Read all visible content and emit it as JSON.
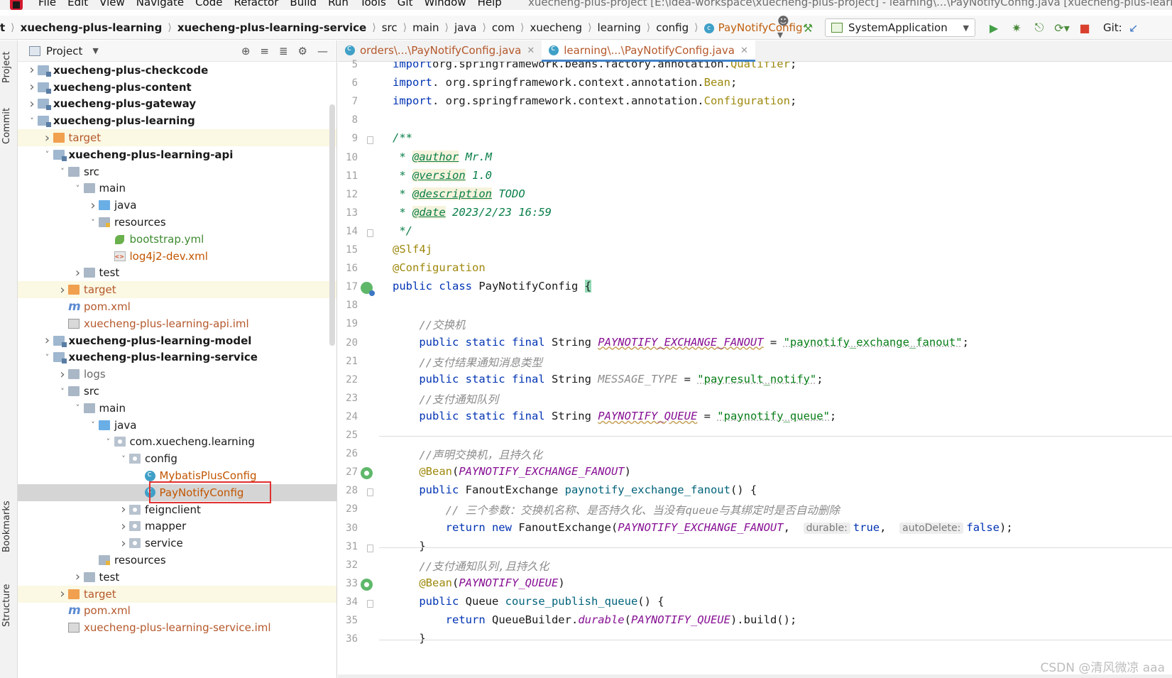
{
  "menu": {
    "items": [
      "File",
      "Edit",
      "View",
      "Navigate",
      "Code",
      "Refactor",
      "Build",
      "Run",
      "Tools",
      "Git",
      "Window",
      "Help"
    ],
    "window_title": "xuecheng-plus-project [E:\\idea-workspace\\xuecheng-plus-project] - learning\\...\\PayNotifyConfig.java [xuecheng-plus-learnin"
  },
  "breadcrumb": [
    {
      "label": "t",
      "bold": true
    },
    {
      "label": "xuecheng-plus-learning",
      "bold": true
    },
    {
      "label": "xuecheng-plus-learning-service",
      "bold": true
    },
    {
      "label": "src",
      "bold": false
    },
    {
      "label": "main",
      "bold": false
    },
    {
      "label": "java",
      "bold": false
    },
    {
      "label": "com",
      "bold": false
    },
    {
      "label": "xuecheng",
      "bold": false
    },
    {
      "label": "learning",
      "bold": false
    },
    {
      "label": "config",
      "bold": false
    },
    {
      "label": "PayNotifyConfig",
      "bold": false,
      "active": true
    }
  ],
  "toolbar": {
    "run_config": "SystemApplication",
    "git_label": "Git:"
  },
  "left_strip": {
    "tabs": [
      "Project",
      "Commit",
      "Bookmarks",
      "Structure"
    ]
  },
  "project_panel": {
    "title": "Project",
    "tree": [
      {
        "label": "xuecheng-plus-checkcode",
        "level": 1,
        "arrow": "right",
        "icon": "module",
        "style": "bold"
      },
      {
        "label": "xuecheng-plus-content",
        "level": 1,
        "arrow": "right",
        "icon": "module",
        "style": "bold"
      },
      {
        "label": "xuecheng-plus-gateway",
        "level": 1,
        "arrow": "right",
        "icon": "module",
        "style": "bold"
      },
      {
        "label": "xuecheng-plus-learning",
        "level": 1,
        "arrow": "down",
        "icon": "module",
        "style": "bold"
      },
      {
        "label": "target",
        "level": 2,
        "arrow": "right",
        "icon": "folder-orange",
        "style": "orange",
        "hl": true
      },
      {
        "label": "xuecheng-plus-learning-api",
        "level": 2,
        "arrow": "down",
        "icon": "module",
        "style": "bold"
      },
      {
        "label": "src",
        "level": 3,
        "arrow": "down",
        "icon": "folder",
        "style": ""
      },
      {
        "label": "main",
        "level": 4,
        "arrow": "down",
        "icon": "folder",
        "style": ""
      },
      {
        "label": "java",
        "level": 5,
        "arrow": "right",
        "icon": "folder-blue",
        "style": ""
      },
      {
        "label": "resources",
        "level": 5,
        "arrow": "down",
        "icon": "folder-res",
        "style": ""
      },
      {
        "label": "bootstrap.yml",
        "level": 6,
        "arrow": "",
        "icon": "yml",
        "style": "green"
      },
      {
        "label": "log4j2-dev.xml",
        "level": 6,
        "arrow": "",
        "icon": "xml",
        "style": "red"
      },
      {
        "label": "test",
        "level": 4,
        "arrow": "right",
        "icon": "folder",
        "style": ""
      },
      {
        "label": "target",
        "level": 3,
        "arrow": "right",
        "icon": "folder-orange",
        "style": "orange",
        "hl": true
      },
      {
        "label": "pom.xml",
        "level": 3,
        "arrow": "",
        "icon": "maven",
        "style": "orange"
      },
      {
        "label": "xuecheng-plus-learning-api.iml",
        "level": 3,
        "arrow": "",
        "icon": "iml",
        "style": "orange"
      },
      {
        "label": "xuecheng-plus-learning-model",
        "level": 2,
        "arrow": "right",
        "icon": "module",
        "style": "bold"
      },
      {
        "label": "xuecheng-plus-learning-service",
        "level": 2,
        "arrow": "down",
        "icon": "module",
        "style": "bold"
      },
      {
        "label": "logs",
        "level": 3,
        "arrow": "right",
        "icon": "folder",
        "style": "gray"
      },
      {
        "label": "src",
        "level": 3,
        "arrow": "down",
        "icon": "folder",
        "style": ""
      },
      {
        "label": "main",
        "level": 4,
        "arrow": "down",
        "icon": "folder",
        "style": ""
      },
      {
        "label": "java",
        "level": 5,
        "arrow": "down",
        "icon": "folder-blue",
        "style": ""
      },
      {
        "label": "com.xuecheng.learning",
        "level": 6,
        "arrow": "down",
        "icon": "package",
        "style": ""
      },
      {
        "label": "config",
        "level": 7,
        "arrow": "down",
        "icon": "package",
        "style": ""
      },
      {
        "label": "MybatisPlusConfig",
        "level": 8,
        "arrow": "",
        "icon": "class",
        "style": "red"
      },
      {
        "label": "PayNotifyConfig",
        "level": 8,
        "arrow": "",
        "icon": "class",
        "style": "red",
        "selected": true
      },
      {
        "label": "feignclient",
        "level": 7,
        "arrow": "right",
        "icon": "package",
        "style": ""
      },
      {
        "label": "mapper",
        "level": 7,
        "arrow": "right",
        "icon": "package",
        "style": ""
      },
      {
        "label": "service",
        "level": 7,
        "arrow": "right",
        "icon": "package",
        "style": ""
      },
      {
        "label": "resources",
        "level": 5,
        "arrow": "",
        "icon": "folder-res",
        "style": ""
      },
      {
        "label": "test",
        "level": 4,
        "arrow": "right",
        "icon": "folder",
        "style": ""
      },
      {
        "label": "target",
        "level": 3,
        "arrow": "right",
        "icon": "folder-orange",
        "style": "orange",
        "hl": true
      },
      {
        "label": "pom.xml",
        "level": 3,
        "arrow": "",
        "icon": "maven",
        "style": "orange"
      },
      {
        "label": "xuecheng-plus-learning-service.iml",
        "level": 3,
        "arrow": "",
        "icon": "iml",
        "style": "orange"
      }
    ]
  },
  "editor": {
    "tabs": [
      {
        "label": "orders\\...\\PayNotifyConfig.java",
        "active": false
      },
      {
        "label": "learning\\...\\PayNotifyConfig.java",
        "active": true
      }
    ],
    "lines": [
      {
        "n": "5",
        "segs": [
          [
            "kw",
            "import"
          ],
          [
            "",
            "org.springframework.beans.factory.annotation."
          ],
          [
            "anno",
            "Qualifier"
          ],
          [
            "",
            ";"
          ]
        ]
      },
      {
        "n": "6",
        "segs": [
          [
            "kw",
            "import"
          ],
          [
            "",
            ". org.springframework.context.annotation."
          ],
          [
            "anno",
            "Bean"
          ],
          [
            "",
            ";"
          ]
        ]
      },
      {
        "n": "7",
        "segs": [
          [
            "kw",
            "import"
          ],
          [
            "",
            ". org.springframework.context.annotation."
          ],
          [
            "anno",
            "Configuration"
          ],
          [
            "",
            ";"
          ]
        ]
      },
      {
        "n": "8",
        "segs": []
      },
      {
        "n": "9",
        "segs": [
          [
            "cmt-green",
            "/**"
          ]
        ]
      },
      {
        "n": "10",
        "segs": [
          [
            "cmt-green",
            " * "
          ],
          [
            "cmt-tag",
            "@author"
          ],
          [
            "cmt-green",
            " Mr.M"
          ]
        ]
      },
      {
        "n": "11",
        "segs": [
          [
            "cmt-green",
            " * "
          ],
          [
            "cmt-tag",
            "@version"
          ],
          [
            "cmt-green",
            " 1.0"
          ]
        ]
      },
      {
        "n": "12",
        "segs": [
          [
            "cmt-green",
            " * "
          ],
          [
            "cmt-tag",
            "@description"
          ],
          [
            "cmt-green",
            " "
          ],
          [
            "todo",
            "TODO"
          ]
        ]
      },
      {
        "n": "13",
        "segs": [
          [
            "cmt-green",
            " * "
          ],
          [
            "cmt-tag",
            "@date"
          ],
          [
            "cmt-green",
            " 2023/2/23 16:59"
          ]
        ]
      },
      {
        "n": "14",
        "segs": [
          [
            "cmt-green",
            " */"
          ]
        ]
      },
      {
        "n": "15",
        "segs": [
          [
            "anno",
            "@Slf4j"
          ]
        ]
      },
      {
        "n": "16",
        "segs": [
          [
            "anno",
            "@Configuration"
          ]
        ]
      },
      {
        "n": "17",
        "segs": [
          [
            "kw",
            "public class"
          ],
          [
            "",
            " PayNotifyConfig "
          ],
          [
            "brace-hl",
            "{"
          ]
        ]
      },
      {
        "n": "18",
        "segs": []
      },
      {
        "n": "19",
        "segs": [
          [
            "",
            "    "
          ],
          [
            "cmt",
            "//交换机"
          ]
        ]
      },
      {
        "n": "20",
        "segs": [
          [
            "",
            "    "
          ],
          [
            "kw",
            "public static final"
          ],
          [
            "",
            " String "
          ],
          [
            "const-u",
            "PAYNOTIFY_EXCHANGE_FANOUT"
          ],
          [
            "",
            " = "
          ],
          [
            "str",
            "\"paynotify_exchange_fanout\""
          ],
          [
            "",
            ";"
          ]
        ]
      },
      {
        "n": "21",
        "segs": [
          [
            "",
            "    "
          ],
          [
            "cmt",
            "//支付结果通知消息类型"
          ]
        ]
      },
      {
        "n": "22",
        "segs": [
          [
            "",
            "    "
          ],
          [
            "kw",
            "public static final"
          ],
          [
            "",
            " String "
          ],
          [
            "const-g",
            "MESSAGE_TYPE"
          ],
          [
            "",
            " = "
          ],
          [
            "str",
            "\"payresult_notify\""
          ],
          [
            "",
            ";"
          ]
        ]
      },
      {
        "n": "23",
        "segs": [
          [
            "",
            "    "
          ],
          [
            "cmt",
            "//支付通知队列"
          ]
        ]
      },
      {
        "n": "24",
        "segs": [
          [
            "",
            "    "
          ],
          [
            "kw",
            "public static final"
          ],
          [
            "",
            " String "
          ],
          [
            "const-u",
            "PAYNOTIFY_QUEUE"
          ],
          [
            "",
            " = "
          ],
          [
            "str",
            "\"paynotify_queue\""
          ],
          [
            "",
            ";"
          ]
        ]
      },
      {
        "n": "25",
        "segs": []
      },
      {
        "n": "26",
        "segs": [
          [
            "",
            "    "
          ],
          [
            "cmt",
            "//声明交换机，且持久化"
          ]
        ]
      },
      {
        "n": "27",
        "segs": [
          [
            "",
            "    "
          ],
          [
            "anno",
            "@Bean"
          ],
          [
            "",
            "("
          ],
          [
            "const",
            "PAYNOTIFY_EXCHANGE_FANOUT"
          ],
          [
            "",
            ")"
          ]
        ]
      },
      {
        "n": "28",
        "segs": [
          [
            "",
            "    "
          ],
          [
            "kw",
            "public"
          ],
          [
            "",
            " FanoutExchange "
          ],
          [
            "fn",
            "paynotify_exchange_fanout"
          ],
          [
            "",
            "() {"
          ]
        ]
      },
      {
        "n": "29",
        "segs": [
          [
            "",
            "        "
          ],
          [
            "cmt",
            "// 三个参数：交换机名称、是否持久化、当没有queue与其绑定时是否自动删除"
          ]
        ]
      },
      {
        "n": "30",
        "segs": [
          [
            "",
            "        "
          ],
          [
            "kw",
            "return new"
          ],
          [
            "",
            " FanoutExchange("
          ],
          [
            "const",
            "PAYNOTIFY_EXCHANGE_FANOUT"
          ],
          [
            "",
            ",  "
          ],
          [
            "hint",
            "durable:"
          ],
          [
            "kw",
            "true"
          ],
          [
            "",
            ",  "
          ],
          [
            "hint",
            "autoDelete:"
          ],
          [
            "kw",
            "false"
          ],
          [
            "",
            ");"
          ]
        ]
      },
      {
        "n": "31",
        "segs": [
          [
            "",
            "    }"
          ]
        ]
      },
      {
        "n": "32",
        "segs": [
          [
            "",
            "    "
          ],
          [
            "cmt",
            "//支付通知队列,且持久化"
          ]
        ]
      },
      {
        "n": "33",
        "segs": [
          [
            "",
            "    "
          ],
          [
            "anno",
            "@Bean"
          ],
          [
            "",
            "("
          ],
          [
            "const",
            "PAYNOTIFY_QUEUE"
          ],
          [
            "",
            ")"
          ]
        ]
      },
      {
        "n": "34",
        "segs": [
          [
            "",
            "    "
          ],
          [
            "kw",
            "public"
          ],
          [
            "",
            " Queue "
          ],
          [
            "fn",
            "course_publish_queue"
          ],
          [
            "",
            "() {"
          ]
        ]
      },
      {
        "n": "35",
        "segs": [
          [
            "",
            "        "
          ],
          [
            "kw",
            "return"
          ],
          [
            "",
            " QueueBuilder."
          ],
          [
            "const",
            "durable"
          ],
          [
            "",
            "("
          ],
          [
            "const",
            "PAYNOTIFY_QUEUE"
          ],
          [
            "",
            ").build();"
          ]
        ]
      },
      {
        "n": "36",
        "segs": [
          [
            "",
            "    }"
          ]
        ]
      }
    ],
    "watermark": "CSDN @清风微凉 aaa"
  }
}
